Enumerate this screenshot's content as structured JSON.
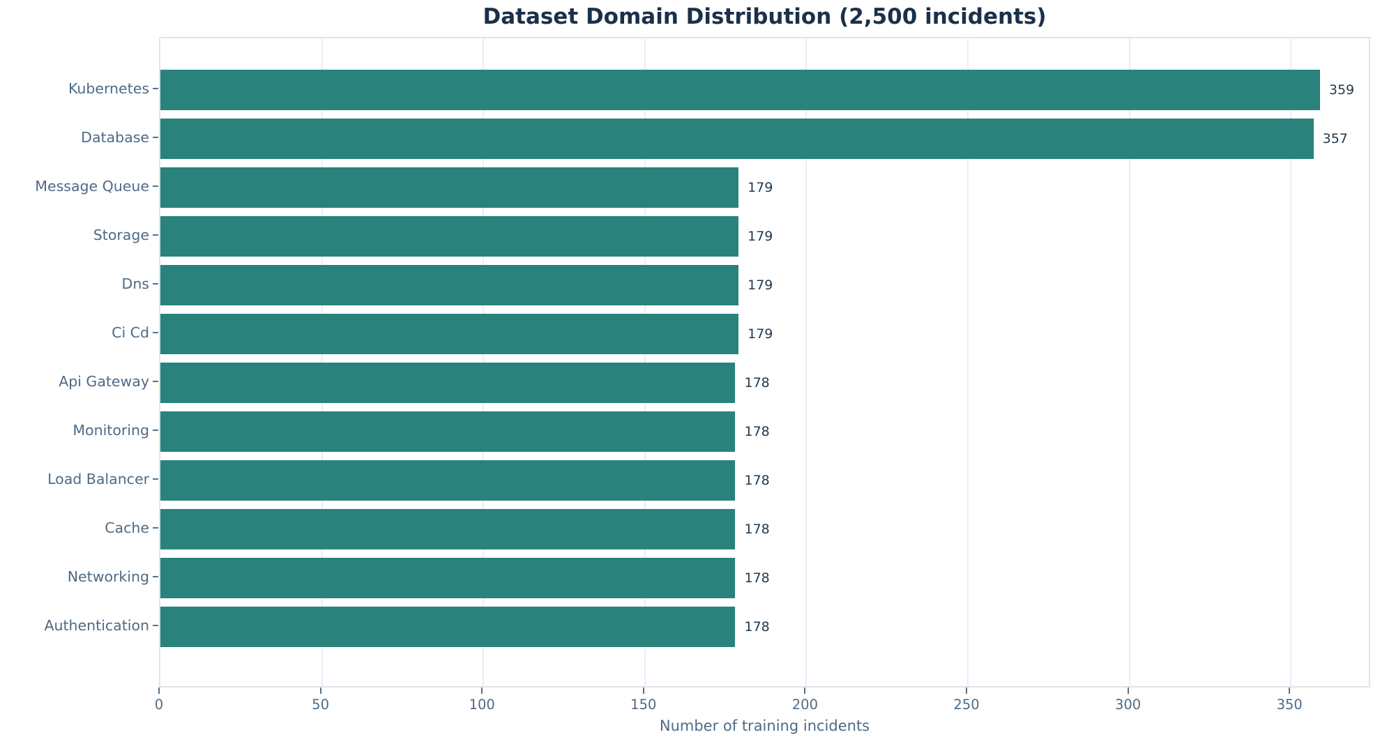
{
  "chart_data": {
    "type": "bar",
    "orientation": "horizontal",
    "title": "Dataset Domain Distribution (2,500 incidents)",
    "xlabel": "Number of training incidents",
    "ylabel": "",
    "categories": [
      "Kubernetes",
      "Database",
      "Message Queue",
      "Storage",
      "Dns",
      "Ci Cd",
      "Api Gateway",
      "Monitoring",
      "Load Balancer",
      "Cache",
      "Networking",
      "Authentication"
    ],
    "values": [
      359,
      357,
      179,
      179,
      179,
      179,
      178,
      178,
      178,
      178,
      178,
      178
    ],
    "value_labels": [
      "359",
      "357",
      "179",
      "179",
      "179",
      "179",
      "178",
      "178",
      "178",
      "178",
      "178",
      "178"
    ],
    "xticks": [
      0,
      50,
      100,
      150,
      200,
      250,
      300,
      350
    ],
    "xlim": [
      0,
      375
    ],
    "grid": "vertical",
    "legend": "none",
    "colors": {
      "bar": "#2a827d",
      "title_text": "#1b3049",
      "axis_text": "#4e6a85",
      "value_text": "#1e3950",
      "gridline": "#e9edf5",
      "plot_border": "#dde3ee",
      "tick_mark": "#5b7186"
    }
  }
}
